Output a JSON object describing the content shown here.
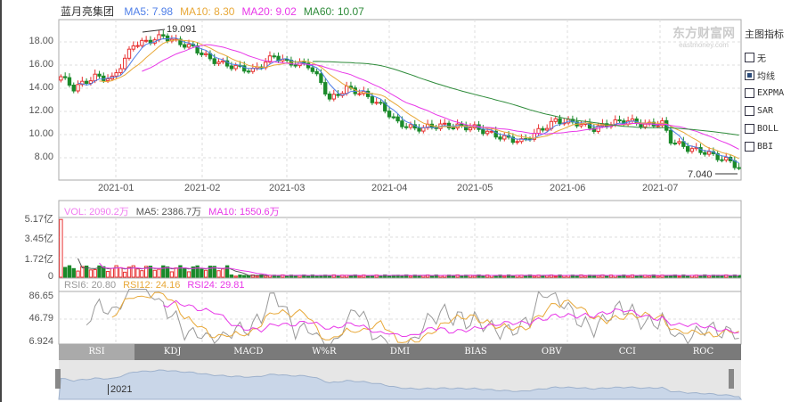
{
  "stock_name": "蓝月亮集团",
  "ma_legend": [
    {
      "label": "MA5: 7.98",
      "color": "#4f7fe8"
    },
    {
      "label": "MA10: 8.30",
      "color": "#e8a838"
    },
    {
      "label": "MA20: 9.02",
      "color": "#e838e8"
    },
    {
      "label": "MA60: 10.07",
      "color": "#2e8b3a"
    }
  ],
  "price_axis": [
    "18.00",
    "16.00",
    "14.00",
    "12.00",
    "10.00",
    "8.00"
  ],
  "max_label": "19.091",
  "min_label": "7.040",
  "watermark": {
    "cn": "东方财富网",
    "en": "eastmoney.com"
  },
  "date_labels": [
    "2021-01",
    "2021-02",
    "2021-03",
    "2021-04",
    "2021-05",
    "2021-06",
    "2021-07"
  ],
  "side_panel": {
    "title": "主图指标",
    "options": [
      {
        "label": "无",
        "checked": false
      },
      {
        "label": "均线",
        "checked": true
      },
      {
        "label": "EXPMA",
        "checked": false
      },
      {
        "label": "SAR",
        "checked": false
      },
      {
        "label": "BOLL",
        "checked": false
      },
      {
        "label": "BBI",
        "checked": false
      }
    ]
  },
  "volume_legend": [
    {
      "label": "VOL: 2090.2万",
      "color": "#f07cf0"
    },
    {
      "label": "MA5: 2386.7万",
      "color": "#555"
    },
    {
      "label": "MA10: 1550.6万",
      "color": "#e838e8"
    }
  ],
  "volume_axis": [
    "5.17亿",
    "3.45亿",
    "1.72亿",
    "0"
  ],
  "rsi_legend": [
    {
      "label": "RSI6: 20.80",
      "color": "#999"
    },
    {
      "label": "RSI12: 24.16",
      "color": "#e8a838"
    },
    {
      "label": "RSI24: 29.81",
      "color": "#e838e8"
    }
  ],
  "rsi_axis": [
    "86.65",
    "46.79",
    "6.924"
  ],
  "tabs": [
    "RSI",
    "KDJ",
    "MACD",
    "W%R",
    "DMI",
    "BIAS",
    "OBV",
    "CCI",
    "ROC"
  ],
  "navigator_label": "2021",
  "chart_data": {
    "type": "candlestick",
    "price_keyframes": [
      [
        0,
        15
      ],
      [
        3,
        14
      ],
      [
        8,
        15
      ],
      [
        12,
        14.8
      ],
      [
        15,
        16.5
      ],
      [
        17,
        17.8
      ],
      [
        20,
        18
      ],
      [
        24,
        18.5
      ],
      [
        27,
        18
      ],
      [
        31,
        17.5
      ],
      [
        35,
        16.5
      ],
      [
        39,
        16
      ],
      [
        45,
        15.5
      ],
      [
        50,
        16.8
      ],
      [
        53,
        16.2
      ],
      [
        58,
        16
      ],
      [
        61,
        14.5
      ],
      [
        63,
        13
      ],
      [
        67,
        14
      ],
      [
        71,
        13.5
      ],
      [
        75,
        12.5
      ],
      [
        79,
        11
      ],
      [
        83,
        10.5
      ],
      [
        89,
        10.8
      ],
      [
        97,
        10.6
      ],
      [
        103,
        9.8
      ],
      [
        108,
        9.4
      ],
      [
        113,
        10.5
      ],
      [
        116,
        11.2
      ],
      [
        121,
        11
      ],
      [
        125,
        10.5
      ],
      [
        129,
        11
      ],
      [
        133,
        11.2
      ],
      [
        137,
        10.8
      ],
      [
        141,
        11
      ],
      [
        143,
        9.5
      ],
      [
        147,
        8.8
      ],
      [
        151,
        8.5
      ],
      [
        155,
        7.9
      ],
      [
        157,
        7.7
      ],
      [
        159,
        7.1
      ]
    ],
    "volume_first_yi": 5.0
  }
}
